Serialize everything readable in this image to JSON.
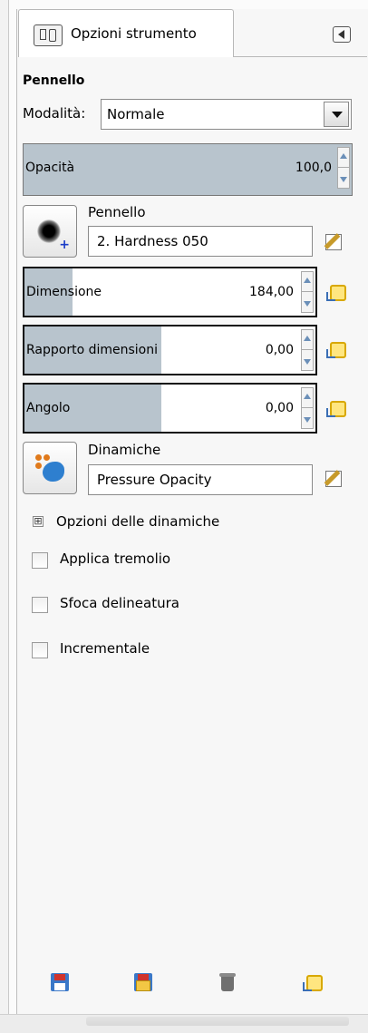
{
  "tab": {
    "label": "Opzioni strumento",
    "icon": "tool-options-icon"
  },
  "section_title": "Pennello",
  "mode": {
    "label": "Modalità:",
    "value": "Normale"
  },
  "opacity": {
    "label": "Opacità",
    "value": "100,0",
    "fill": 1.0
  },
  "brush": {
    "label": "Pennello",
    "value": "2. Hardness 050"
  },
  "size": {
    "label": "Dimensione",
    "value": "184,00",
    "fill": 0.17
  },
  "aspect": {
    "label": "Rapporto dimensioni",
    "value": "0,00",
    "fill": 0.5
  },
  "angle": {
    "label": "Angolo",
    "value": "0,00",
    "fill": 0.5
  },
  "dynamics": {
    "label": "Dinamiche",
    "value": "Pressure Opacity"
  },
  "dynamics_options": {
    "label": "Opzioni delle dinamiche",
    "expander_glyph": "⊞"
  },
  "checkboxes": [
    {
      "label": "Applica tremolio",
      "checked": false
    },
    {
      "label": "Sfoca delineatura",
      "checked": false
    },
    {
      "label": "Incrementale",
      "checked": false
    }
  ],
  "colors": {
    "fill": "#b8c4cd",
    "reset_accent": "#d8a800"
  }
}
